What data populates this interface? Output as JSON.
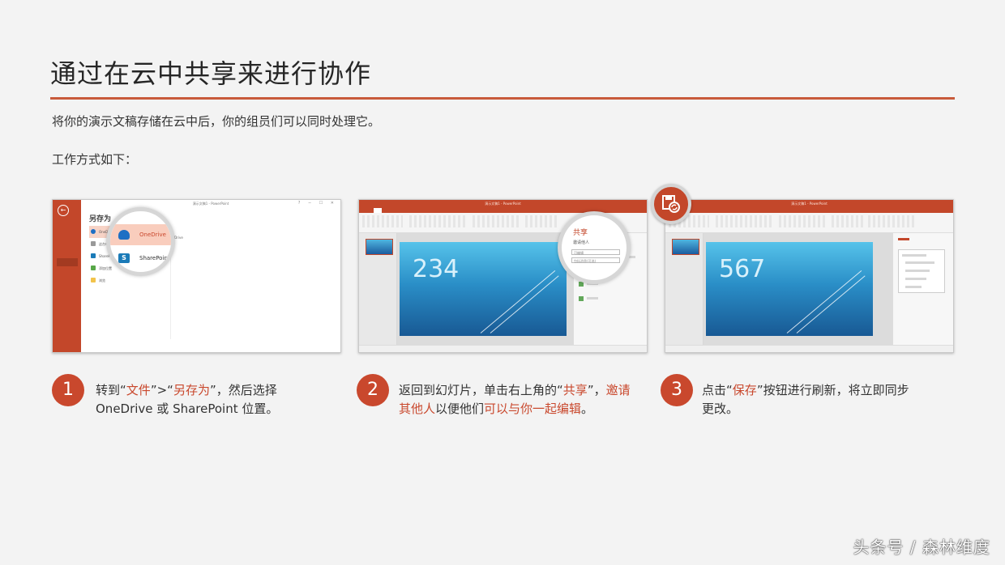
{
  "page": {
    "title": "通过在云中共享来进行协作",
    "intro": "将你的演示文稿存储在云中后，你的组员们可以同时处理它。",
    "howto": "工作方式如下："
  },
  "screenshot_1": {
    "window_title": "演示文稿1 - PowerPoint",
    "heading": "另存为",
    "locations": [
      "OneDrive",
      "这台电脑",
      "SharePoint",
      "添加位置",
      "浏览"
    ],
    "selected": "OneDrive",
    "side_label": "OneDrive",
    "magnifier": {
      "onedrive": "OneDrive",
      "sharepoint": "SharePoint"
    }
  },
  "screenshot_2": {
    "window_title": "演示文稿1 - PowerPoint",
    "slide_number": "234",
    "share_panel": {
      "title": "共享",
      "invite": "邀请他人",
      "can_edit": "可编辑",
      "message": "包括消息(可选)"
    }
  },
  "screenshot_3": {
    "window_title": "演示文稿1 - PowerPoint",
    "slide_number": "567"
  },
  "steps": [
    {
      "number": "1",
      "text": {
        "a": "转到",
        "q1": "“",
        "hl1": "文件",
        "q2": "”>“",
        "hl2": "另存为",
        "b": "”，然后选择 OneDrive 或 SharePoint 位置。"
      }
    },
    {
      "number": "2",
      "text": {
        "a": "返回到幻灯片，单击右上角的",
        "q1": "“",
        "hl1": "共享",
        "q2": "”，",
        "hl2": "邀请其他人",
        "b": "以便他们",
        "hl3": "可以与你一起编辑",
        "c": "。"
      }
    },
    {
      "number": "3",
      "text": {
        "a": "点击",
        "q1": "“",
        "hl1": "保存",
        "q2": "”",
        "b": "按钮进行刷新，将立即同步更改。"
      }
    }
  ],
  "watermark": "头条号 / 森林维度",
  "colors": {
    "accent": "#c9482d",
    "ppt_orange": "#c3472a",
    "background": "#f3f3f3"
  }
}
